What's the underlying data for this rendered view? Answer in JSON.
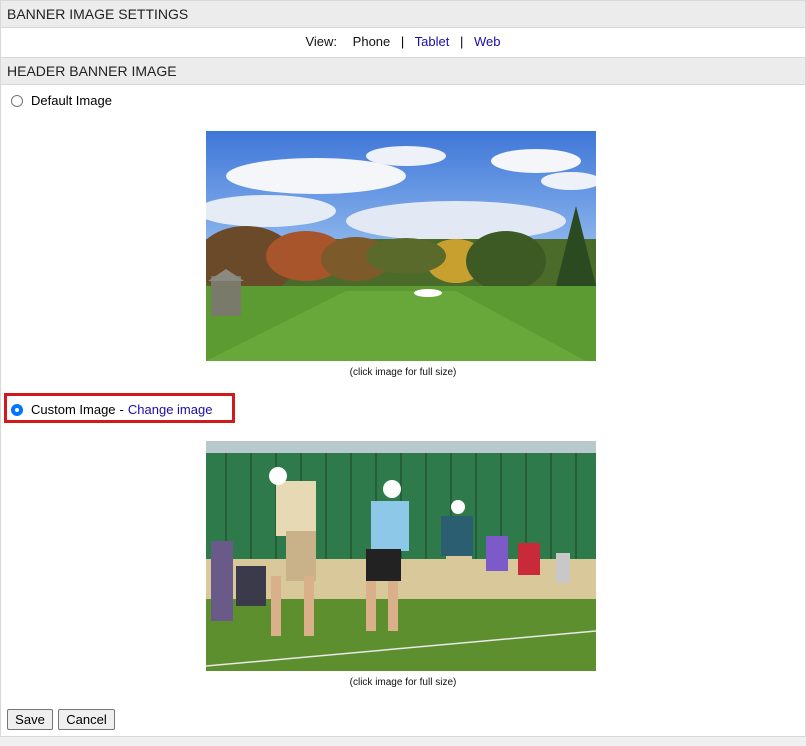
{
  "section1": {
    "title": "BANNER IMAGE SETTINGS"
  },
  "view": {
    "label": "View:",
    "phone": "Phone",
    "tablet": "Tablet",
    "web": "Web",
    "separator": "|"
  },
  "section2": {
    "title": "HEADER BANNER IMAGE"
  },
  "default_option": {
    "label": "Default Image",
    "selected": false,
    "caption": "(click image for full size)"
  },
  "custom_option": {
    "label": "Custom Image",
    "dash": "-",
    "link": "Change image",
    "selected": true,
    "caption": "(click image for full size)"
  },
  "buttons": {
    "save": "Save",
    "cancel": "Cancel"
  },
  "colors": {
    "link": "#1a0dab",
    "highlight": "#d21a1a",
    "radio": "#0075ff"
  }
}
